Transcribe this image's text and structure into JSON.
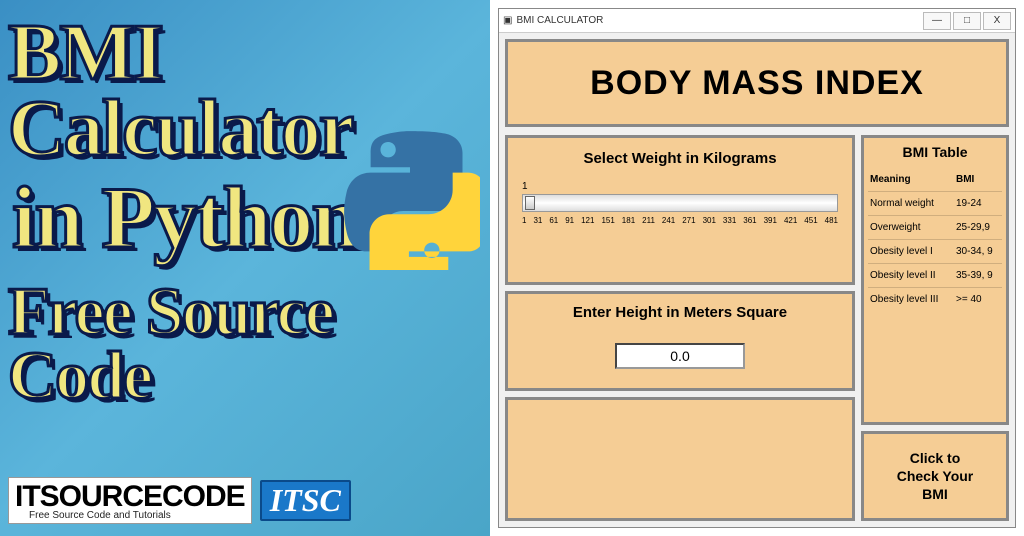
{
  "promo": {
    "line1": "BMI Calculator",
    "line2": "in Python",
    "line3": "Free Source Code",
    "brand_main": "ITSOURCECODE",
    "brand_sub": "Free Source Code and Tutorials",
    "brand_badge": "ITSC"
  },
  "window": {
    "title": "BMI CALCULATOR",
    "minimize": "—",
    "maximize": "□",
    "close": "X"
  },
  "app": {
    "header": "BODY MASS INDEX",
    "weight_label": "Select Weight in Kilograms",
    "slider_value": "1",
    "slider_ticks": [
      "1",
      "31",
      "61",
      "91",
      "121",
      "151",
      "181",
      "211",
      "241",
      "271",
      "301",
      "331",
      "361",
      "391",
      "421",
      "451",
      "481"
    ],
    "height_label": "Enter Height in Meters Square",
    "height_value": "0.0",
    "check_button": "Click to\nCheck Your\nBMI"
  },
  "bmi_table": {
    "title": "BMI Table",
    "header": {
      "meaning": "Meaning",
      "bmi": "BMI"
    },
    "rows": [
      {
        "meaning": "Normal weight",
        "bmi": "19-24"
      },
      {
        "meaning": "Overweight",
        "bmi": "25-29,9"
      },
      {
        "meaning": "Obesity level I",
        "bmi": "30-34, 9"
      },
      {
        "meaning": "Obesity level II",
        "bmi": "35-39, 9"
      },
      {
        "meaning": "Obesity level III",
        "bmi": ">= 40"
      }
    ]
  }
}
